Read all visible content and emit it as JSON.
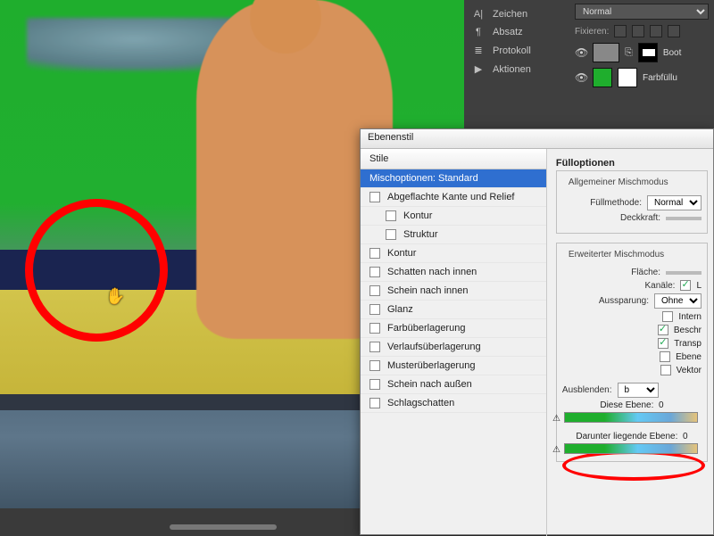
{
  "panels": {
    "items": [
      {
        "icon": "A|",
        "label": "Zeichen"
      },
      {
        "icon": "¶",
        "label": "Absatz"
      },
      {
        "icon": "≣",
        "label": "Protokoll"
      },
      {
        "icon": "▶",
        "label": "Aktionen"
      }
    ],
    "topBlendMode": "Normal",
    "fixLabel": "Fixieren:",
    "layers": [
      {
        "name": "Boot",
        "kind": "image"
      },
      {
        "name": "Farbfüllu",
        "kind": "fill"
      }
    ]
  },
  "dialog": {
    "title": "Ebenenstil",
    "stylesHeader": "Stile",
    "styles": [
      {
        "label": "Mischoptionen: Standard",
        "selected": true,
        "checkbox": false
      },
      {
        "label": "Abgeflachte Kante und Relief",
        "checkbox": true
      },
      {
        "label": "Kontur",
        "checkbox": true,
        "indent": true
      },
      {
        "label": "Struktur",
        "checkbox": true,
        "indent": true
      },
      {
        "label": "Kontur",
        "checkbox": true
      },
      {
        "label": "Schatten nach innen",
        "checkbox": true
      },
      {
        "label": "Schein nach innen",
        "checkbox": true
      },
      {
        "label": "Glanz",
        "checkbox": true
      },
      {
        "label": "Farbüberlagerung",
        "checkbox": true
      },
      {
        "label": "Verlaufsüberlagerung",
        "checkbox": true
      },
      {
        "label": "Musterüberlagerung",
        "checkbox": true
      },
      {
        "label": "Schein nach außen",
        "checkbox": true
      },
      {
        "label": "Schlagschatten",
        "checkbox": true
      }
    ],
    "opts": {
      "groupTitle": "Fülloptionen",
      "generalTitle": "Allgemeiner Mischmodus",
      "fillMethodLabel": "Füllmethode:",
      "fillMethodValue": "Normal",
      "opacityLabel": "Deckkraft:",
      "advTitle": "Erweiterter Mischmodus",
      "surfaceLabel": "Fläche:",
      "channelsLabel": "Kanäle:",
      "channelL": "L",
      "knockoutLabel": "Aussparung:",
      "knockoutValue": "Ohne",
      "flags": [
        {
          "label": "Intern",
          "checked": false
        },
        {
          "label": "Beschr",
          "checked": true
        },
        {
          "label": "Transp",
          "checked": true
        },
        {
          "label": "Ebene",
          "checked": false
        },
        {
          "label": "Vektor",
          "checked": false
        }
      ],
      "blendIfLabel": "Ausblenden:",
      "blendIfValue": "b",
      "thisLayerLabel": "Diese Ebene:",
      "thisLayerVal": "0",
      "underLayerLabel": "Darunter liegende Ebene:",
      "underLayerVal": "0"
    }
  }
}
